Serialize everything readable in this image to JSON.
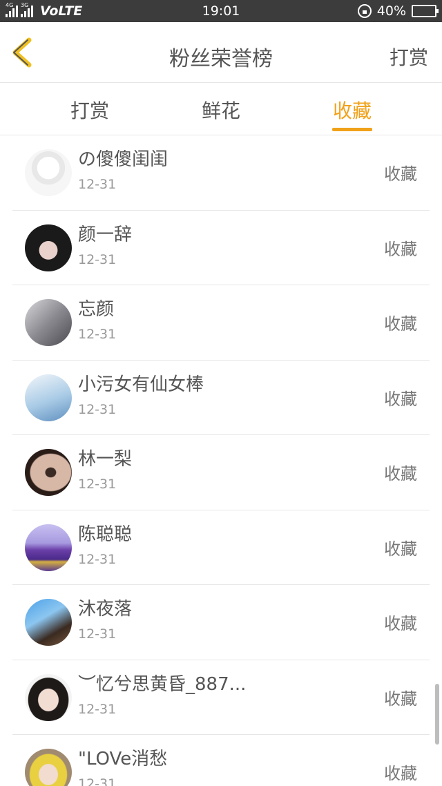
{
  "status_bar": {
    "net1": "4G",
    "net2": "3G",
    "carrier": "VoLTE",
    "time": "19:01",
    "battery": "40%",
    "battery_level": 0.4,
    "battery_color": "#6ad12a"
  },
  "header": {
    "title": "粉丝荣誉榜",
    "right_action": "打赏",
    "back_icon": "chevron-left-icon",
    "accent_color": "#f0a21a"
  },
  "tabs": [
    {
      "label": "打赏",
      "active": false
    },
    {
      "label": "鲜花",
      "active": false
    },
    {
      "label": "收藏",
      "active": true
    }
  ],
  "list": [
    {
      "name": "の傻傻闺闺",
      "date": "12-31",
      "action": "收藏"
    },
    {
      "name": "颜一辞",
      "date": "12-31",
      "action": "收藏"
    },
    {
      "name": "忘颜",
      "date": "12-31",
      "action": "收藏"
    },
    {
      "name": "小污女有仙女棒",
      "date": "12-31",
      "action": "收藏"
    },
    {
      "name": "林一梨",
      "date": "12-31",
      "action": "收藏"
    },
    {
      "name": "陈聪聪",
      "date": "12-31",
      "action": "收藏"
    },
    {
      "name": "沐夜落",
      "date": "12-31",
      "action": "收藏"
    },
    {
      "name": "︶忆兮思黄昏_887...",
      "date": "12-31",
      "action": "收藏"
    },
    {
      "name": "\"LOVe消愁",
      "date": "12-31",
      "action": "收藏"
    }
  ]
}
